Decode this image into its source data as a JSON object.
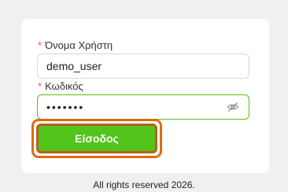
{
  "form": {
    "required_marker": "*",
    "username": {
      "label": "Όνομα Χρήστη",
      "value": "demo_user"
    },
    "password": {
      "label": "Κωδικός",
      "value": "•••••••",
      "toggle_icon": "eye-slash-icon"
    },
    "submit_label": "Είσοδος"
  },
  "footer": {
    "text": "All rights reserved 2026."
  },
  "colors": {
    "primary_green": "#52c41a",
    "focus_orange": "#e06a12",
    "required_red": "#ff4d4f"
  }
}
